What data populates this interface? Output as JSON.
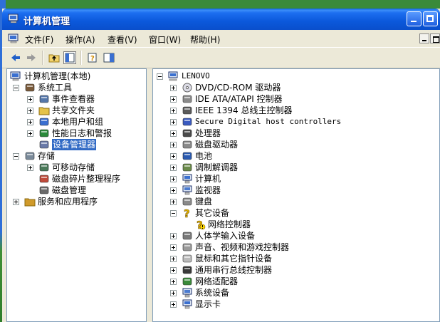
{
  "window": {
    "title": "计算机管理"
  },
  "menu": {
    "items": [
      "文件(F)",
      "操作(A)",
      "查看(V)",
      "窗口(W)",
      "帮助(H)"
    ]
  },
  "left_tree": {
    "root": "计算机管理(本地)",
    "items": [
      {
        "label": "系统工具",
        "level": 1,
        "expander": "minus",
        "icon": "tools-icon"
      },
      {
        "label": "事件查看器",
        "level": 2,
        "expander": "plus",
        "icon": "event-viewer-icon"
      },
      {
        "label": "共享文件夹",
        "level": 2,
        "expander": "plus",
        "icon": "shared-folder-icon"
      },
      {
        "label": "本地用户和组",
        "level": 2,
        "expander": "plus",
        "icon": "users-icon"
      },
      {
        "label": "性能日志和警报",
        "level": 2,
        "expander": "plus",
        "icon": "performance-icon"
      },
      {
        "label": "设备管理器",
        "level": 2,
        "expander": "none",
        "icon": "device-manager-icon",
        "selected": true
      },
      {
        "label": "存储",
        "level": 1,
        "expander": "minus",
        "icon": "storage-icon"
      },
      {
        "label": "可移动存储",
        "level": 2,
        "expander": "plus",
        "icon": "removable-storage-icon"
      },
      {
        "label": "磁盘碎片整理程序",
        "level": 2,
        "expander": "none",
        "icon": "defrag-icon"
      },
      {
        "label": "磁盘管理",
        "level": 2,
        "expander": "none",
        "icon": "disk-management-icon"
      },
      {
        "label": "服务和应用程序",
        "level": 1,
        "expander": "plus",
        "icon": "services-icon"
      }
    ]
  },
  "right_tree": {
    "root": "LENOVO",
    "items": [
      {
        "label": "DVD/CD-ROM 驱动器",
        "level": 1,
        "expander": "plus",
        "icon": "cdrom-icon"
      },
      {
        "label": "IDE ATA/ATAPI 控制器",
        "level": 1,
        "expander": "plus",
        "icon": "ide-controller-icon"
      },
      {
        "label": "IEEE 1394 总线主控制器",
        "level": 1,
        "expander": "plus",
        "icon": "ieee1394-icon"
      },
      {
        "label": "Secure Digital host controllers",
        "level": 1,
        "expander": "plus",
        "icon": "sd-host-icon"
      },
      {
        "label": "处理器",
        "level": 1,
        "expander": "plus",
        "icon": "processor-icon"
      },
      {
        "label": "磁盘驱动器",
        "level": 1,
        "expander": "plus",
        "icon": "disk-drive-icon"
      },
      {
        "label": "电池",
        "level": 1,
        "expander": "plus",
        "icon": "battery-icon"
      },
      {
        "label": "调制解调器",
        "level": 1,
        "expander": "plus",
        "icon": "modem-icon"
      },
      {
        "label": "计算机",
        "level": 1,
        "expander": "plus",
        "icon": "computer-icon"
      },
      {
        "label": "监视器",
        "level": 1,
        "expander": "plus",
        "icon": "monitor-icon"
      },
      {
        "label": "键盘",
        "level": 1,
        "expander": "plus",
        "icon": "keyboard-icon"
      },
      {
        "label": "其它设备",
        "level": 1,
        "expander": "minus",
        "icon": "unknown-device-icon"
      },
      {
        "label": "网络控制器",
        "level": 2,
        "expander": "none",
        "icon": "unknown-device-warning-icon"
      },
      {
        "label": "人体学输入设备",
        "level": 1,
        "expander": "plus",
        "icon": "hid-icon"
      },
      {
        "label": "声音、视频和游戏控制器",
        "level": 1,
        "expander": "plus",
        "icon": "sound-icon"
      },
      {
        "label": "鼠标和其它指针设备",
        "level": 1,
        "expander": "plus",
        "icon": "mouse-icon"
      },
      {
        "label": "通用串行总线控制器",
        "level": 1,
        "expander": "plus",
        "icon": "usb-icon"
      },
      {
        "label": "网络适配器",
        "level": 1,
        "expander": "plus",
        "icon": "network-adapter-icon"
      },
      {
        "label": "系统设备",
        "level": 1,
        "expander": "plus",
        "icon": "system-devices-icon"
      },
      {
        "label": "显示卡",
        "level": 1,
        "expander": "plus",
        "icon": "display-adapter-icon"
      }
    ]
  }
}
